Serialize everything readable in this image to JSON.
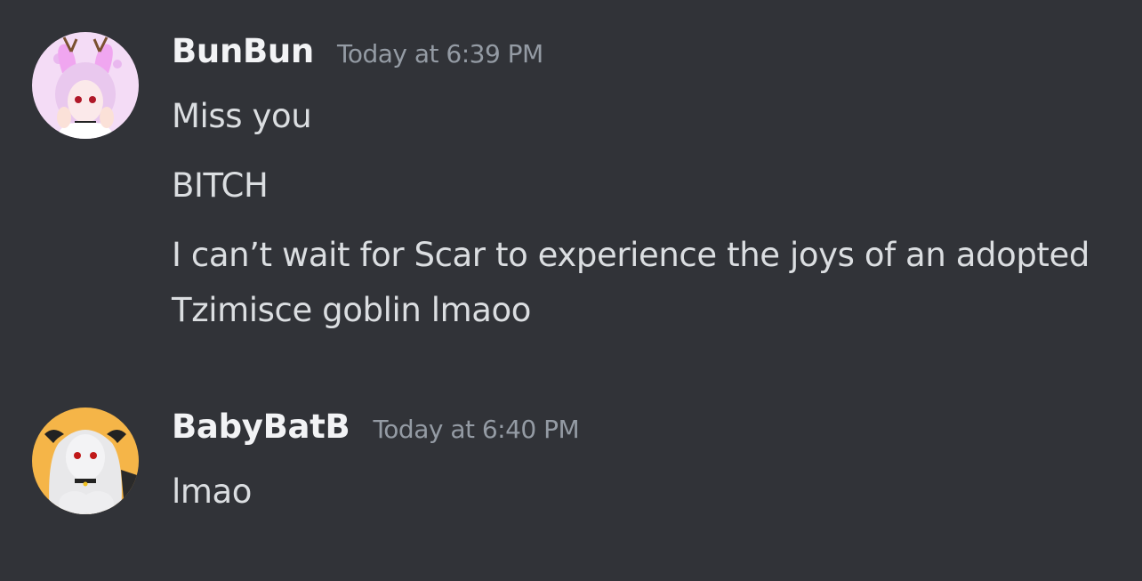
{
  "colors": {
    "background": "#313338",
    "username": "#f2f3f5",
    "timestamp": "#949ba4",
    "message_text": "#dbdee1"
  },
  "messages": [
    {
      "username": "BunBun",
      "timestamp": "Today at 6:39 PM",
      "avatar": "pink-bunny-anime-avatar",
      "lines": [
        "Miss you",
        "BITCH",
        "I can’t wait for Scar to experience the joys of an adopted Tzimisce goblin lmaoo"
      ]
    },
    {
      "username": "BabyBatB",
      "timestamp": "Today at 6:40 PM",
      "avatar": "white-haired-horned-anime-avatar",
      "lines": [
        "lmao"
      ]
    }
  ]
}
